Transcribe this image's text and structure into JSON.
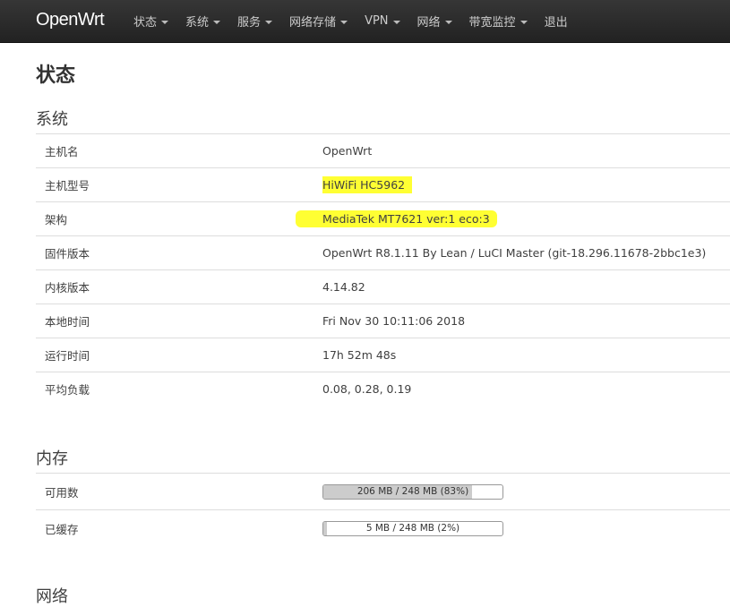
{
  "header": {
    "brand": "OpenWrt",
    "menu": [
      {
        "label": "状态",
        "dropdown": true
      },
      {
        "label": "系统",
        "dropdown": true
      },
      {
        "label": "服务",
        "dropdown": true
      },
      {
        "label": "网络存储",
        "dropdown": true
      },
      {
        "label": "VPN",
        "dropdown": true
      },
      {
        "label": "网络",
        "dropdown": true
      },
      {
        "label": "带宽监控",
        "dropdown": true
      },
      {
        "label": "退出",
        "dropdown": false
      }
    ]
  },
  "page_title": "状态",
  "system": {
    "title": "系统",
    "rows": [
      {
        "key": "主机名",
        "value": "OpenWrt"
      },
      {
        "key": "主机型号",
        "value": "HiWiFi HC5962"
      },
      {
        "key": "架构",
        "value": "MediaTek MT7621 ver:1 eco:3"
      },
      {
        "key": "固件版本",
        "value": "OpenWrt R8.1.11 By Lean / LuCI Master (git-18.296.11678-2bbc1e3)"
      },
      {
        "key": "内核版本",
        "value": "4.14.82"
      },
      {
        "key": "本地时间",
        "value": "Fri Nov 30 10:11:06 2018"
      },
      {
        "key": "运行时间",
        "value": "17h 52m 48s"
      },
      {
        "key": "平均负载",
        "value": "0.08, 0.28, 0.19"
      }
    ]
  },
  "memory": {
    "title": "内存",
    "rows": [
      {
        "key": "可用数",
        "value": "206 MB / 248 MB (83%)",
        "fraction": 0.83
      },
      {
        "key": "已缓存",
        "value": "5 MB / 248 MB (2%)",
        "fraction": 0.02
      }
    ]
  },
  "network": {
    "title": "网络"
  },
  "colors": {
    "navbar": "#222222",
    "highlight": "#ffff33",
    "progress_fill": "#cccccc"
  }
}
